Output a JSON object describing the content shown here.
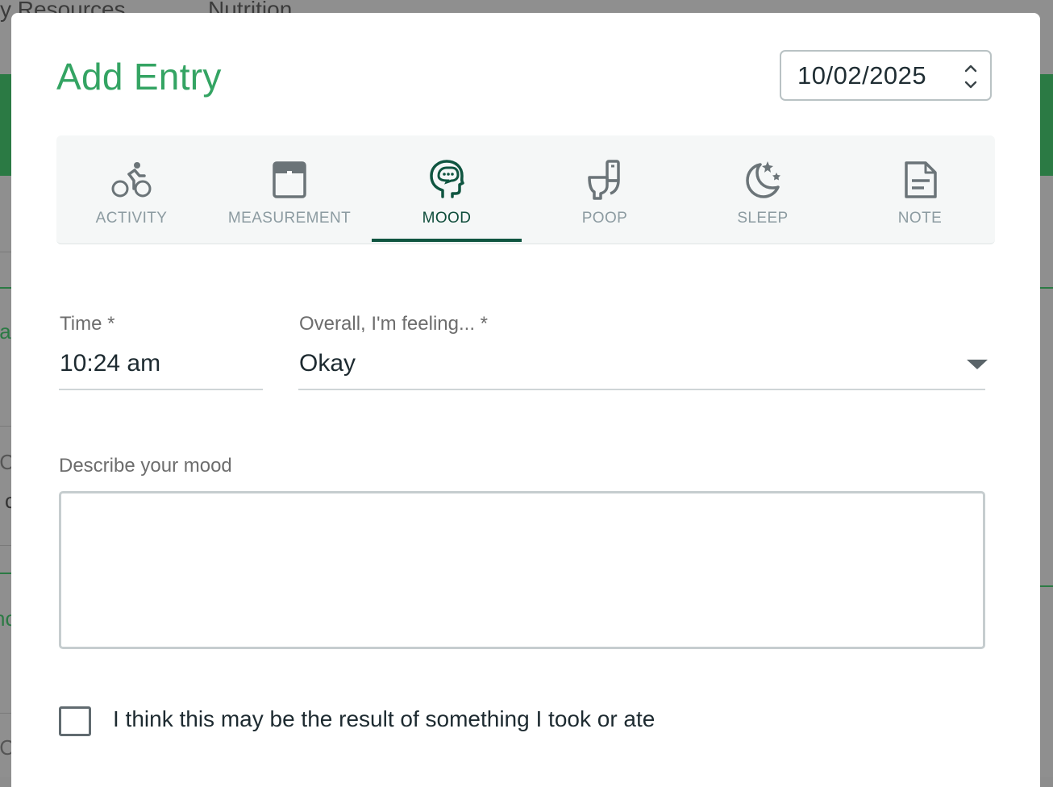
{
  "background": {
    "nav_items": [
      "y Resources",
      "Nutrition"
    ],
    "edge_fragments": [
      "fa",
      "IC",
      "c",
      "nc",
      "IC"
    ]
  },
  "modal": {
    "title": "Add Entry",
    "date": {
      "value": "10/02/2025"
    },
    "tabs": [
      {
        "label": "ACTIVITY",
        "icon": "bicycle-icon"
      },
      {
        "label": "MEASUREMENT",
        "icon": "scale-icon"
      },
      {
        "label": "MOOD",
        "icon": "mood-head-icon",
        "active": true
      },
      {
        "label": "POOP",
        "icon": "toilet-icon"
      },
      {
        "label": "SLEEP",
        "icon": "moon-stars-icon"
      },
      {
        "label": "NOTE",
        "icon": "note-icon"
      }
    ],
    "time": {
      "label": "Time *",
      "value": "10:24 am"
    },
    "feeling": {
      "label": "Overall, I'm feeling... *",
      "value": "Okay"
    },
    "describe": {
      "label": "Describe your mood",
      "value": ""
    },
    "checkbox": {
      "label": "I think this may be the result of something I took or ate",
      "checked": false
    },
    "colors": {
      "title": "#34a463",
      "active_tab": "#0f5540",
      "inactive_tab": "#8c9ba1"
    }
  }
}
